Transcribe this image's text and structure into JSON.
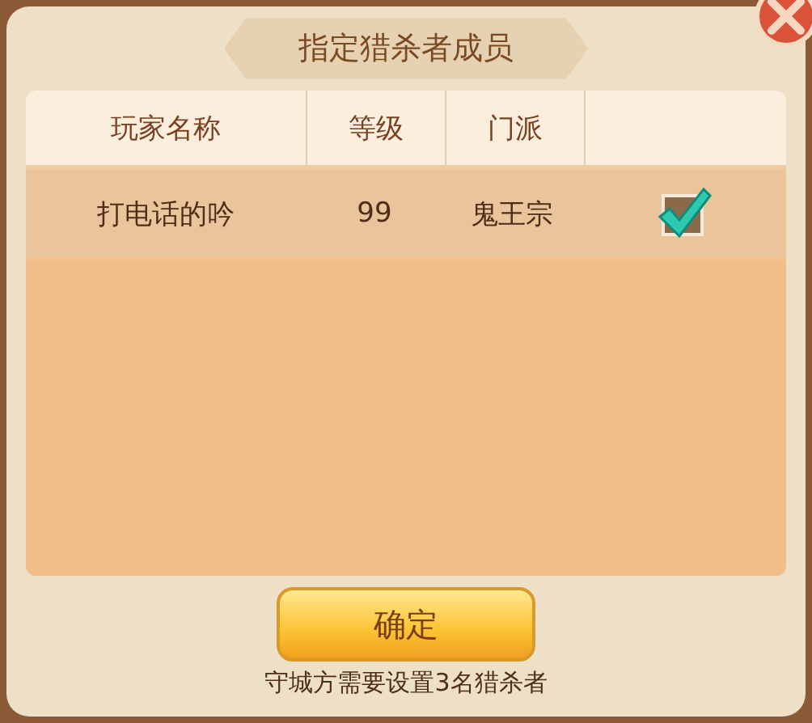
{
  "dialog": {
    "title": "指定猎杀者成员"
  },
  "table": {
    "columns": [
      "玩家名称",
      "等级",
      "门派"
    ],
    "rows": [
      {
        "name": "打电话的吟",
        "level_text": "99",
        "faction": "鬼王宗",
        "checked": true
      }
    ]
  },
  "confirm_button": "确定",
  "footnote": "守城方需要设置3名猎杀者"
}
